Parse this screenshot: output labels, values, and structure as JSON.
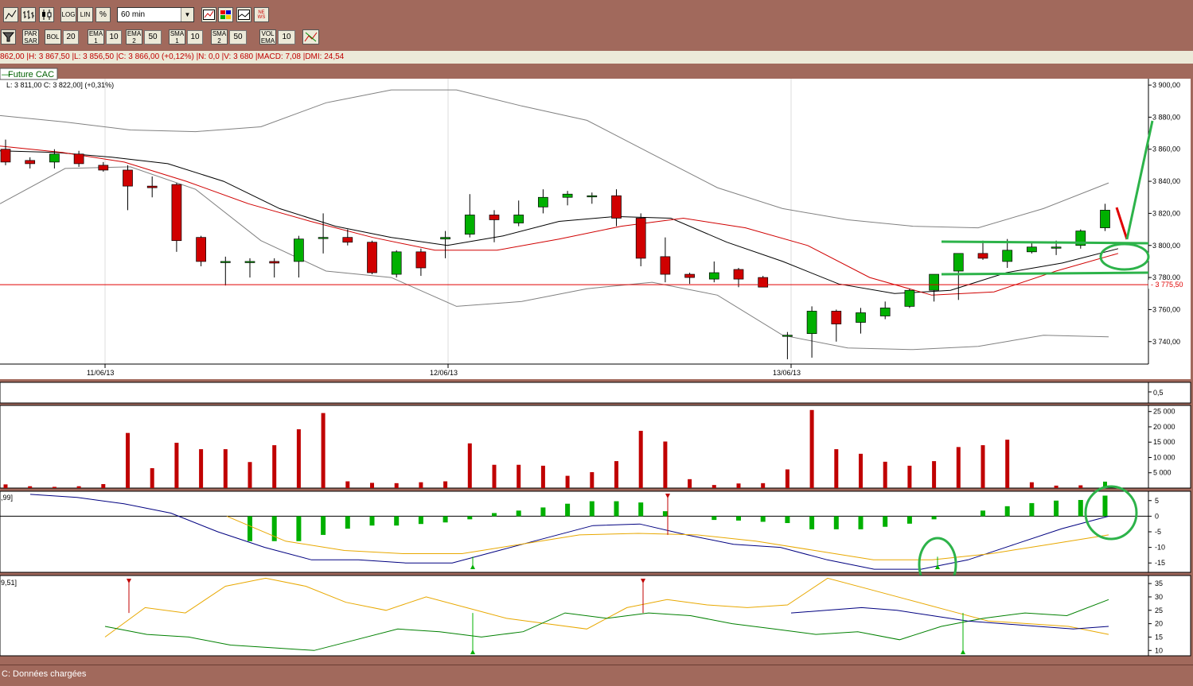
{
  "window": {
    "period_select": "60 min",
    "toolbar_labels": {
      "log": "LOG",
      "lin": "LIN",
      "pct": "%",
      "news": "NEWS",
      "parsar": "PAR SAR",
      "bol": "BOL",
      "ema1": "EMA 1",
      "ema2": "EMA 2",
      "sma1": "SMA 1",
      "sma2": "SMA 2",
      "volema": "VOL EMA"
    },
    "toolbar_values": {
      "bol": "20",
      "ema1": "10",
      "ema2": "50",
      "sma1": "10",
      "sma2": "50",
      "volema": "10"
    }
  },
  "info_line": "862,00 |H: 3 867,50 |L: 3 856,50 |C: 3 866,00 (+0,12%) |N: 0,0 |V: 3 680 |MACD: 7,08 |DMI: 24,54",
  "legend": "Future CAC",
  "ohlc_line": "L: 3 811,00  C: 3 822,00] (+0,31%)",
  "status_text": "C: Données chargées",
  "colors": {
    "frame": "#a1695c",
    "up": "#00b000",
    "down": "#d00000",
    "annotation": "#2db34a"
  },
  "chart_data": {
    "type": "candlestick",
    "x_labels": [
      "11/06/13",
      "12/06/13",
      "13/06/13"
    ],
    "price_axis": {
      "ticks": [
        "3 900,00",
        "3 880,00",
        "3 860,00",
        "3 840,00",
        "3 820,00",
        "3 800,00",
        "3 780,00",
        "3 760,00",
        "3 740,00"
      ],
      "ylim": [
        3726,
        3904
      ]
    },
    "support_level": {
      "value": 3775.5,
      "label": "3 775,50"
    },
    "ohlc": [
      [
        3860,
        3866,
        3850,
        3852
      ],
      [
        3853,
        3855,
        3848,
        3851
      ],
      [
        3852,
        3860,
        3848,
        3857
      ],
      [
        3857,
        3859,
        3849,
        3851
      ],
      [
        3850,
        3852,
        3846,
        3847
      ],
      [
        3847,
        3850,
        3822,
        3837
      ],
      [
        3837,
        3843,
        3830,
        3836
      ],
      [
        3838,
        3839,
        3796,
        3803
      ],
      [
        3805,
        3806,
        3787,
        3790
      ],
      [
        3790,
        3793,
        3775,
        3790
      ],
      [
        3790,
        3792,
        3780,
        3790
      ],
      [
        3790,
        3792,
        3780,
        3789
      ],
      [
        3790,
        3806,
        3780,
        3804
      ],
      [
        3805,
        3820,
        3795,
        3805
      ],
      [
        3805,
        3810,
        3800,
        3802
      ],
      [
        3802,
        3803,
        3782,
        3783
      ],
      [
        3782,
        3797,
        3780,
        3796
      ],
      [
        3796,
        3798,
        3781,
        3786
      ],
      [
        3804,
        3809,
        3792,
        3805
      ],
      [
        3807,
        3832,
        3805,
        3819
      ],
      [
        3819,
        3822,
        3802,
        3816
      ],
      [
        3814,
        3828,
        3812,
        3819
      ],
      [
        3824,
        3835,
        3820,
        3830
      ],
      [
        3830,
        3834,
        3825,
        3832
      ],
      [
        3831,
        3833,
        3826,
        3831
      ],
      [
        3831,
        3835,
        3812,
        3817
      ],
      [
        3817,
        3820,
        3787,
        3792
      ],
      [
        3793,
        3805,
        3777,
        3782
      ],
      [
        3782,
        3783,
        3776,
        3780
      ],
      [
        3779,
        3790,
        3777,
        3783
      ],
      [
        3785,
        3786,
        3774,
        3779
      ],
      [
        3780,
        3781,
        3774,
        3774
      ],
      [
        3744,
        3746,
        3729,
        3744
      ],
      [
        3745,
        3762,
        3730,
        3759
      ],
      [
        3759,
        3760,
        3740,
        3751
      ],
      [
        3752,
        3761,
        3745,
        3758
      ],
      [
        3756,
        3765,
        3754,
        3761
      ],
      [
        3762,
        3773,
        3761,
        3772
      ],
      [
        3772,
        3782,
        3765,
        3782
      ],
      [
        3784,
        3795,
        3766,
        3795
      ],
      [
        3795,
        3803,
        3791,
        3792
      ],
      [
        3790,
        3804,
        3786,
        3797
      ],
      [
        3796,
        3802,
        3795,
        3799
      ],
      [
        3799,
        3803,
        3794,
        3799
      ],
      [
        3800,
        3810,
        3798,
        3809
      ],
      [
        3811,
        3826,
        3809,
        3822
      ]
    ],
    "indicators": {
      "bollinger_upper": [
        3881,
        3877,
        3872,
        3871,
        3874,
        3889,
        3897,
        3897,
        3887,
        3878,
        3857,
        3836,
        3823,
        3816,
        3812,
        3811,
        3823,
        3839
      ],
      "bollinger_lower": [
        3826,
        3848,
        3849,
        3835,
        3803,
        3784,
        3780,
        3762,
        3765,
        3773,
        3777,
        3769,
        3744,
        3736,
        3735,
        3737,
        3744,
        3743
      ],
      "ema_10": [
        3859,
        3858,
        3855,
        3851,
        3840,
        3823,
        3812,
        3805,
        3800,
        3806,
        3815,
        3818,
        3817,
        3802,
        3790,
        3776,
        3770,
        3772,
        3783,
        3789,
        3798
      ],
      "ema_50": [
        3862,
        3858,
        3852,
        3840,
        3826,
        3815,
        3805,
        3797,
        3797,
        3804,
        3812,
        3817,
        3811,
        3800,
        3780,
        3769,
        3771,
        3784,
        3795
      ]
    },
    "volume": {
      "axis_ticks": [
        "25 000",
        "20 000",
        "15 000",
        "10 000",
        "5 000"
      ],
      "values": [
        1200,
        600,
        400,
        600,
        1300,
        18000,
        6500,
        14800,
        12700,
        12700,
        8500,
        14000,
        19200,
        24500,
        2200,
        1700,
        1600,
        1900,
        2200,
        14600,
        7600,
        7600,
        7300,
        4000,
        5200,
        8800,
        18700,
        15200,
        2900,
        1000,
        1500,
        1600,
        6100,
        25500,
        12700,
        11200,
        8600,
        7300,
        8800,
        13400,
        14000,
        15800,
        1900,
        800,
        900,
        2100
      ]
    },
    "macd": {
      "label": ",99]",
      "axis_ticks": [
        "5",
        "0",
        "-5",
        "-10",
        "-15"
      ],
      "histogram": [
        0,
        0,
        0,
        0,
        0,
        0,
        0,
        0,
        -8,
        -8,
        -8,
        -6,
        -4,
        -3,
        -3,
        -2.5,
        -2,
        -1,
        1,
        1.8,
        2.8,
        4,
        4.8,
        4.8,
        4.4,
        1.6,
        0,
        -1.2,
        -1.4,
        -1.8,
        -2.2,
        -4.2,
        -4.2,
        -4.2,
        -3.4,
        -2.4,
        -1,
        0,
        1.8,
        3.2,
        4.2,
        5,
        5.2,
        6.6
      ],
      "macd_line": [
        7,
        6,
        4,
        1,
        -5,
        -10,
        -14,
        -14,
        -15,
        -15,
        -11,
        -7,
        -3,
        -2.5,
        -6,
        -9,
        -10,
        -14,
        -17,
        -17,
        -14,
        -9,
        -4,
        0
      ],
      "signal_line": [
        0,
        -8,
        -11,
        -12,
        -12,
        -9,
        -6,
        -5.5,
        -6,
        -8,
        -11,
        -14,
        -14,
        -12,
        -9,
        -6
      ]
    },
    "dmi": {
      "label": "9,51]",
      "axis_ticks": [
        "35",
        "30",
        "25",
        "20",
        "15",
        "10"
      ],
      "adx": [
        15,
        26,
        24,
        34,
        37,
        34,
        28,
        25,
        30,
        26,
        22,
        20,
        18,
        26,
        29,
        27,
        26,
        27,
        37,
        33,
        29,
        25,
        21,
        20,
        19,
        16
      ],
      "plus_di": [
        19,
        16,
        15,
        12,
        11,
        10,
        14,
        18,
        17,
        15,
        17,
        24,
        22,
        24,
        23,
        20,
        18,
        16,
        17,
        14,
        19,
        22,
        24,
        23,
        29
      ],
      "minus_di": [
        24,
        25,
        26,
        25,
        23,
        21,
        20,
        19,
        18,
        19
      ]
    }
  }
}
